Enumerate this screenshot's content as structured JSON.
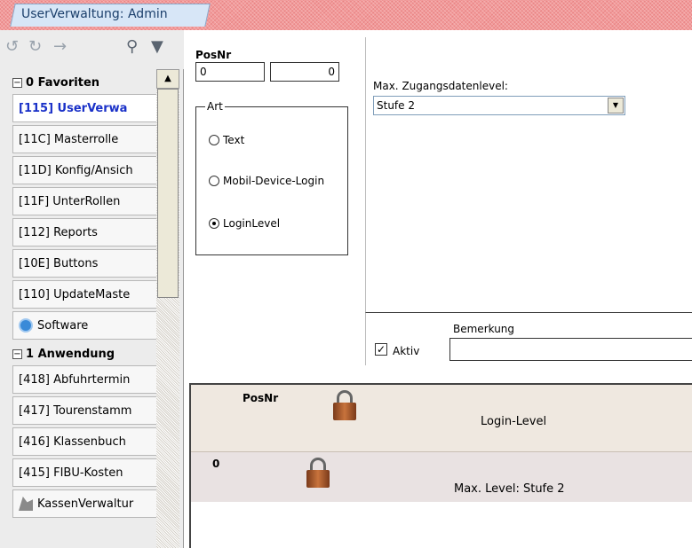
{
  "window": {
    "tab_title": "UserVerwaltung: Admin"
  },
  "toolbar": {
    "icons": [
      "undo-icon",
      "redo-icon",
      "forward-arrow-icon",
      "search-icon",
      "filter-add-icon"
    ]
  },
  "sidebar": {
    "groups": [
      {
        "label": "0 Favoriten",
        "expander": "−"
      },
      {
        "label": "1 Anwendung",
        "expander": "−"
      }
    ],
    "favorites": [
      "[115] UserVerwa",
      "[11C] Masterrolle",
      "[11D] Konfig/Ansich",
      "[11F] UnterRollen",
      "[112] Reports",
      "[10E] Buttons",
      "[110] UpdateMaste",
      "Software"
    ],
    "anwendung": [
      "[418] Abfuhrtermin",
      "[417] Tourenstamm",
      "[416] Klassenbuch",
      "[415] FIBU-Kosten",
      "KassenVerwaltur"
    ]
  },
  "form": {
    "posnr_label": "PosNr",
    "posnr_value": "0",
    "posnr_value2": "0",
    "art_label": "Art",
    "radio_options": [
      "Text",
      "Mobil-Device-Login",
      "LoginLevel"
    ],
    "selected_option": "LoginLevel",
    "max_level_label": "Max. Zugangsdatenlevel:",
    "max_level_value": "Stufe 2",
    "aktiv_label": "Aktiv",
    "aktiv_checked": true,
    "bemerkung_label": "Bemerkung",
    "bemerkung_value": ""
  },
  "grid": {
    "header": {
      "posnr": "PosNr",
      "title": "Login-Level"
    },
    "rows": [
      {
        "posnr": "0",
        "text": "Max. Level: Stufe 2"
      }
    ]
  }
}
